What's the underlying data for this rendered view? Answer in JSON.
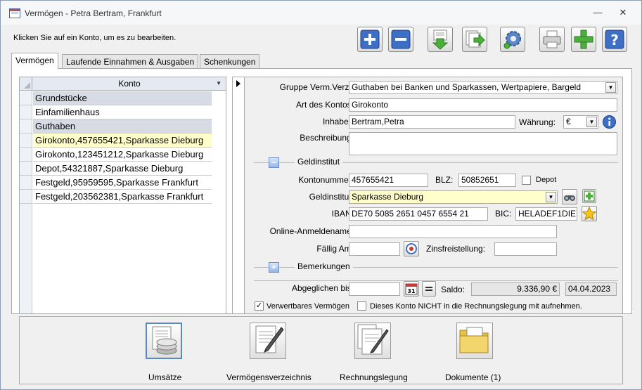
{
  "window": {
    "title": "Vermögen - Petra Bertram, Frankfurt"
  },
  "hint": "Klicken Sie auf ein Konto, um es zu bearbeiten.",
  "toolbar": {
    "buttons": [
      "add",
      "remove",
      "import",
      "export",
      "settings",
      "print",
      "new",
      "help"
    ]
  },
  "tabs": [
    {
      "label": "Vermögen"
    },
    {
      "label": "Laufende Einnahmen & Ausgaben"
    },
    {
      "label": "Schenkungen"
    }
  ],
  "list": {
    "header": "Konto",
    "rows": [
      {
        "text": "Grundstücke",
        "type": "group"
      },
      {
        "text": "Einfamilienhaus",
        "type": "item"
      },
      {
        "text": "Guthaben",
        "type": "group"
      },
      {
        "text": "Girokonto,457655421,Sparkasse Dieburg",
        "type": "current"
      },
      {
        "text": "Girokonto,123451212,Sparkasse Dieburg",
        "type": "item"
      },
      {
        "text": "Depot,54321887,Sparkasse Dieburg",
        "type": "item"
      },
      {
        "text": "Festgeld,95959595,Sparkasse Frankfurt",
        "type": "item"
      },
      {
        "text": "Festgeld,203562381,Sparkasse Frankfurt",
        "type": "item"
      }
    ]
  },
  "form": {
    "gruppe_label": "Gruppe Verm.Verz.:",
    "gruppe_value": "Guthaben bei Banken und Sparkassen, Wertpapiere, Bargeld",
    "art_label": "Art des Kontos:",
    "art_value": "Girokonto",
    "inhaber_label": "Inhaber:",
    "inhaber_value": "Bertram,Petra",
    "waehrung_label": "Währung:",
    "waehrung_value": "€",
    "beschreibung_label": "Beschreibung:",
    "beschreibung_value": "",
    "geldinstitut_section": "Geldinstitut",
    "kontonummer_label": "Kontonummer:",
    "kontonummer_value": "457655421",
    "blz_label": "BLZ:",
    "blz_value": "50852651",
    "depot_label": "Depot",
    "geldinstitut_label": "Geldinstitut:",
    "geldinstitut_value": "Sparkasse Dieburg",
    "iban_label": "IBAN:",
    "iban_value": "DE70 5085 2651 0457 6554 21",
    "bic_label": "BIC:",
    "bic_value": "HELADEF1DIE",
    "online_label": "Online-Anmeldename:",
    "online_value": "",
    "faellig_label": "Fällig Am:",
    "faellig_value": "",
    "zins_label": "Zinsfreistellung:",
    "zins_value": "",
    "bemerkungen_section": "Bemerkungen",
    "abgeglichen_label": "Abgeglichen bis:",
    "abgeglichen_value": "",
    "saldo_label": "Saldo:",
    "saldo_value": "9.336,90 €",
    "saldo_date": "04.04.2023",
    "verwertbar_label": "Verwertbares Vermögen",
    "nicht_label": "Dieses Konto NICHT in die Rechnungslegung mit aufnehmen."
  },
  "bottom": {
    "umsaetze": "Umsätze",
    "verzeichnis": "Vermögensverzeichnis",
    "rechnungslegung": "Rechnungslegung",
    "dokumente": "Dokumente (1)"
  },
  "colors": {
    "accent": "#5d87c4",
    "highlight": "#ffffcc",
    "group": "#d6dbe4"
  }
}
